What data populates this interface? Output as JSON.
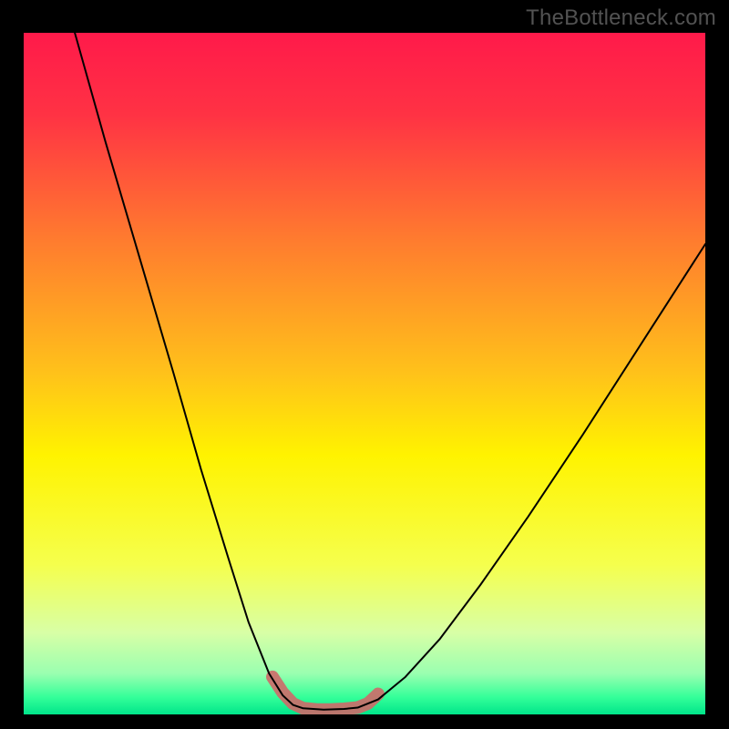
{
  "watermark": "TheBottleneck.com",
  "chart_data": {
    "type": "line",
    "title": "",
    "xlabel": "",
    "ylabel": "",
    "xlim": [
      0,
      100
    ],
    "ylim": [
      0,
      100
    ],
    "background_gradient": {
      "stops": [
        {
          "pos": 0.0,
          "color": "#ff1a4a"
        },
        {
          "pos": 0.12,
          "color": "#ff3244"
        },
        {
          "pos": 0.3,
          "color": "#ff7a2f"
        },
        {
          "pos": 0.5,
          "color": "#ffc21a"
        },
        {
          "pos": 0.62,
          "color": "#fff300"
        },
        {
          "pos": 0.78,
          "color": "#f5ff4d"
        },
        {
          "pos": 0.88,
          "color": "#d8ffa6"
        },
        {
          "pos": 0.94,
          "color": "#9affb0"
        },
        {
          "pos": 0.975,
          "color": "#33ff99"
        },
        {
          "pos": 1.0,
          "color": "#00e58a"
        }
      ]
    },
    "series": [
      {
        "name": "left-curve",
        "comment": "Main thin black curve, left branch (descends from top-left to trough)",
        "stroke": "#000000",
        "width": 2,
        "x": [
          7.5,
          12,
          17,
          22,
          26,
          30,
          33,
          36,
          38,
          39.5,
          41
        ],
        "y": [
          100,
          84,
          67,
          50,
          36,
          23,
          13.5,
          6,
          2.8,
          1.4,
          0.9
        ]
      },
      {
        "name": "trough-flat",
        "comment": "Near-flat bottom of the V",
        "stroke": "#000000",
        "width": 2,
        "x": [
          41,
          44,
          47,
          49
        ],
        "y": [
          0.9,
          0.7,
          0.8,
          1.0
        ]
      },
      {
        "name": "right-curve",
        "comment": "Main thin black curve, right branch (rises from trough toward upper-right, exits partway up)",
        "stroke": "#000000",
        "width": 2,
        "x": [
          49,
          52,
          56,
          61,
          67,
          74,
          82,
          91,
          100
        ],
        "y": [
          1.0,
          2.2,
          5.5,
          11,
          19,
          29,
          41,
          55,
          69
        ]
      },
      {
        "name": "highlight-band",
        "comment": "Thick desaturated-red overlay hugging the trough region of the curve",
        "stroke": "#cf6a6a",
        "width": 14,
        "x": [
          36.5,
          38,
          39.5,
          41,
          43,
          45,
          47,
          49,
          50.5,
          52
        ],
        "y": [
          5.5,
          3.2,
          1.6,
          0.9,
          0.7,
          0.7,
          0.8,
          1.0,
          1.6,
          3.0
        ]
      }
    ]
  }
}
